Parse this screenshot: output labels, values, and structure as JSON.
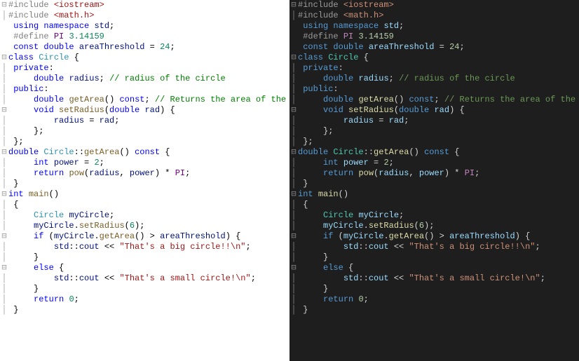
{
  "tokens": {
    "include": "#include",
    "iostream": "<iostream>",
    "math": "<math.h>",
    "using": "using",
    "namespace": "namespace",
    "std": "std",
    "define": "#define",
    "PI": "PI",
    "pi_val": "3.14159",
    "const": "const",
    "double": "double",
    "areaThreshold": "areaThreshold",
    "thresh_val": "24",
    "class": "class",
    "Circle": "Circle",
    "private": "private",
    "public": "public",
    "radius": "radius",
    "cmt_radius": "// radius of the circle",
    "getArea": "getArea",
    "cmt_getarea": "// Returns the area of the circle",
    "void": "void",
    "setRadius": "setRadius",
    "rad": "rad",
    "int": "int",
    "power": "power",
    "two": "2",
    "return": "return",
    "pow": "pow",
    "main": "main",
    "myCircle": "myCircle",
    "six": "6",
    "if": "if",
    "cout": "cout",
    "str_big": "\"That's a big circle!!\\n\"",
    "else": "else",
    "str_small": "\"That's a small circle!\\n\"",
    "zero": "0",
    "semi": ";",
    "colon": ":",
    "dcolon": "::",
    "lbrace": "{",
    "rbrace": "}",
    "lparen": "(",
    "rparen": ")",
    "comma": ",",
    "eq": "=",
    "gt": ">",
    "star": "*",
    "dot": ".",
    "ins": "<<",
    "empty": ""
  },
  "foldMinus": "⊟",
  "foldBar": "│",
  "lines": [
    {
      "g": "m",
      "t": [
        [
          "c-pre",
          "include"
        ],
        [
          "c-def",
          " "
        ],
        [
          "c-inc",
          "iostream"
        ]
      ]
    },
    {
      "g": "b",
      "t": [
        [
          "c-pre",
          "include"
        ],
        [
          "c-def",
          " "
        ],
        [
          "c-inc",
          "math"
        ]
      ]
    },
    {
      "g": "",
      "t": []
    },
    {
      "g": "",
      "t": [
        [
          "c-def",
          " "
        ],
        [
          "c-kw",
          "using"
        ],
        [
          "c-def",
          " "
        ],
        [
          "c-kw",
          "namespace"
        ],
        [
          "c-def",
          " "
        ],
        [
          "c-var",
          "std"
        ],
        [
          "c-def",
          "semi"
        ]
      ]
    },
    {
      "g": "",
      "t": [
        [
          "c-def",
          " "
        ],
        [
          "c-pre",
          "define"
        ],
        [
          "c-def",
          " "
        ],
        [
          "c-macro",
          "PI"
        ],
        [
          "c-def",
          " "
        ],
        [
          "c-num",
          "pi_val"
        ]
      ]
    },
    {
      "g": "",
      "t": [
        [
          "c-def",
          " "
        ],
        [
          "c-kw",
          "const"
        ],
        [
          "c-def",
          " "
        ],
        [
          "c-type",
          "double"
        ],
        [
          "c-def",
          " "
        ],
        [
          "c-var",
          "areaThreshold"
        ],
        [
          "c-def",
          " "
        ],
        [
          "c-def",
          "eq"
        ],
        [
          "c-def",
          " "
        ],
        [
          "c-num",
          "thresh_val"
        ],
        [
          "c-def",
          "semi"
        ]
      ]
    },
    {
      "g": "",
      "t": []
    },
    {
      "g": "m",
      "t": [
        [
          "c-kw",
          "class"
        ],
        [
          "c-def",
          " "
        ],
        [
          "c-typec",
          "Circle"
        ],
        [
          "c-def",
          " "
        ],
        [
          "c-def",
          "lbrace"
        ]
      ]
    },
    {
      "g": "b",
      "t": [
        [
          "c-def",
          " "
        ],
        [
          "c-kw",
          "private"
        ],
        [
          "c-def",
          "colon"
        ]
      ]
    },
    {
      "g": "b",
      "t": [
        [
          "c-def",
          "     "
        ],
        [
          "c-type",
          "double"
        ],
        [
          "c-def",
          " "
        ],
        [
          "c-var",
          "radius"
        ],
        [
          "c-def",
          "semi"
        ],
        [
          "c-def",
          " "
        ],
        [
          "c-cmt",
          "cmt_radius"
        ]
      ]
    },
    {
      "g": "b",
      "t": [
        [
          "c-def",
          " "
        ],
        [
          "c-kw",
          "public"
        ],
        [
          "c-def",
          "colon"
        ]
      ]
    },
    {
      "g": "b",
      "t": [
        [
          "c-def",
          "     "
        ],
        [
          "c-type",
          "double"
        ],
        [
          "c-def",
          " "
        ],
        [
          "c-func",
          "getArea"
        ],
        [
          "c-def",
          "lparen"
        ],
        [
          "c-def",
          "rparen"
        ],
        [
          "c-def",
          " "
        ],
        [
          "c-kw",
          "const"
        ],
        [
          "c-def",
          "semi"
        ],
        [
          "c-def",
          " "
        ],
        [
          "c-cmt",
          "cmt_getarea"
        ]
      ]
    },
    {
      "g": "m",
      "t": [
        [
          "c-def",
          "     "
        ],
        [
          "c-type",
          "void"
        ],
        [
          "c-def",
          " "
        ],
        [
          "c-func",
          "setRadius"
        ],
        [
          "c-def",
          "lparen"
        ],
        [
          "c-type",
          "double"
        ],
        [
          "c-def",
          " "
        ],
        [
          "c-var",
          "rad"
        ],
        [
          "c-def",
          "rparen"
        ],
        [
          "c-def",
          " "
        ],
        [
          "c-def",
          "lbrace"
        ]
      ]
    },
    {
      "g": "b",
      "t": [
        [
          "c-def",
          "         "
        ],
        [
          "c-var",
          "radius"
        ],
        [
          "c-def",
          " "
        ],
        [
          "c-def",
          "eq"
        ],
        [
          "c-def",
          " "
        ],
        [
          "c-var",
          "rad"
        ],
        [
          "c-def",
          "semi"
        ]
      ]
    },
    {
      "g": "b",
      "t": [
        [
          "c-def",
          "     "
        ],
        [
          "c-def",
          "rbrace"
        ],
        [
          "c-def",
          "semi"
        ]
      ]
    },
    {
      "g": "b",
      "t": [
        [
          "c-def",
          " "
        ],
        [
          "c-def",
          "rbrace"
        ],
        [
          "c-def",
          "semi"
        ]
      ]
    },
    {
      "g": "m",
      "t": [
        [
          "c-type",
          "double"
        ],
        [
          "c-def",
          " "
        ],
        [
          "c-typec",
          "Circle"
        ],
        [
          "c-def",
          "dcolon"
        ],
        [
          "c-func",
          "getArea"
        ],
        [
          "c-def",
          "lparen"
        ],
        [
          "c-def",
          "rparen"
        ],
        [
          "c-def",
          " "
        ],
        [
          "c-kw",
          "const"
        ],
        [
          "c-def",
          " "
        ],
        [
          "c-def",
          "lbrace"
        ]
      ]
    },
    {
      "g": "b",
      "t": [
        [
          "c-def",
          "     "
        ],
        [
          "c-type",
          "int"
        ],
        [
          "c-def",
          " "
        ],
        [
          "c-var",
          "power"
        ],
        [
          "c-def",
          " "
        ],
        [
          "c-def",
          "eq"
        ],
        [
          "c-def",
          " "
        ],
        [
          "c-num",
          "two"
        ],
        [
          "c-def",
          "semi"
        ]
      ]
    },
    {
      "g": "b",
      "t": [
        [
          "c-def",
          "     "
        ],
        [
          "c-kw",
          "return"
        ],
        [
          "c-def",
          " "
        ],
        [
          "c-func",
          "pow"
        ],
        [
          "c-def",
          "lparen"
        ],
        [
          "c-var",
          "radius"
        ],
        [
          "c-def",
          "comma"
        ],
        [
          "c-def",
          " "
        ],
        [
          "c-var",
          "power"
        ],
        [
          "c-def",
          "rparen"
        ],
        [
          "c-def",
          " "
        ],
        [
          "c-def",
          "star"
        ],
        [
          "c-def",
          " "
        ],
        [
          "c-macro",
          "PI"
        ],
        [
          "c-def",
          "semi"
        ]
      ]
    },
    {
      "g": "b",
      "t": [
        [
          "c-def",
          " "
        ],
        [
          "c-def",
          "rbrace"
        ]
      ]
    },
    {
      "g": "",
      "t": []
    },
    {
      "g": "",
      "t": []
    },
    {
      "g": "m",
      "t": [
        [
          "c-type",
          "int"
        ],
        [
          "c-def",
          " "
        ],
        [
          "c-func",
          "main"
        ],
        [
          "c-def",
          "lparen"
        ],
        [
          "c-def",
          "rparen"
        ]
      ]
    },
    {
      "g": "b",
      "t": [
        [
          "c-def",
          " "
        ],
        [
          "c-def",
          "lbrace"
        ]
      ]
    },
    {
      "g": "b",
      "t": [
        [
          "c-def",
          "     "
        ],
        [
          "c-typec",
          "Circle"
        ],
        [
          "c-def",
          " "
        ],
        [
          "c-var",
          "myCircle"
        ],
        [
          "c-def",
          "semi"
        ]
      ]
    },
    {
      "g": "b",
      "t": [
        [
          "c-def",
          "     "
        ],
        [
          "c-var",
          "myCircle"
        ],
        [
          "c-def",
          "dot"
        ],
        [
          "c-func",
          "setRadius"
        ],
        [
          "c-def",
          "lparen"
        ],
        [
          "c-num",
          "six"
        ],
        [
          "c-def",
          "rparen"
        ],
        [
          "c-def",
          "semi"
        ]
      ]
    },
    {
      "g": "m",
      "t": [
        [
          "c-def",
          "     "
        ],
        [
          "c-kw",
          "if"
        ],
        [
          "c-def",
          " "
        ],
        [
          "c-def",
          "lparen"
        ],
        [
          "c-var",
          "myCircle"
        ],
        [
          "c-def",
          "dot"
        ],
        [
          "c-func",
          "getArea"
        ],
        [
          "c-def",
          "lparen"
        ],
        [
          "c-def",
          "rparen"
        ],
        [
          "c-def",
          " "
        ],
        [
          "c-def",
          "gt"
        ],
        [
          "c-def",
          " "
        ],
        [
          "c-var",
          "areaThreshold"
        ],
        [
          "c-def",
          "rparen"
        ],
        [
          "c-def",
          " "
        ],
        [
          "c-def",
          "lbrace"
        ]
      ]
    },
    {
      "g": "b",
      "t": [
        [
          "c-def",
          "         "
        ],
        [
          "c-var",
          "std"
        ],
        [
          "c-def",
          "dcolon"
        ],
        [
          "c-var",
          "cout"
        ],
        [
          "c-def",
          " "
        ],
        [
          "c-def",
          "ins"
        ],
        [
          "c-def",
          " "
        ],
        [
          "c-str",
          "str_big"
        ],
        [
          "c-def",
          "semi"
        ]
      ]
    },
    {
      "g": "b",
      "t": [
        [
          "c-def",
          "     "
        ],
        [
          "c-def",
          "rbrace"
        ]
      ]
    },
    {
      "g": "m",
      "t": [
        [
          "c-def",
          "     "
        ],
        [
          "c-kw",
          "else"
        ],
        [
          "c-def",
          " "
        ],
        [
          "c-def",
          "lbrace"
        ]
      ]
    },
    {
      "g": "b",
      "t": [
        [
          "c-def",
          "         "
        ],
        [
          "c-var",
          "std"
        ],
        [
          "c-def",
          "dcolon"
        ],
        [
          "c-var",
          "cout"
        ],
        [
          "c-def",
          " "
        ],
        [
          "c-def",
          "ins"
        ],
        [
          "c-def",
          " "
        ],
        [
          "c-str",
          "str_small"
        ],
        [
          "c-def",
          "semi"
        ]
      ]
    },
    {
      "g": "b",
      "t": [
        [
          "c-def",
          "     "
        ],
        [
          "c-def",
          "rbrace"
        ]
      ]
    },
    {
      "g": "b",
      "t": [
        [
          "c-def",
          "     "
        ],
        [
          "c-kw",
          "return"
        ],
        [
          "c-def",
          " "
        ],
        [
          "c-num",
          "zero"
        ],
        [
          "c-def",
          "semi"
        ]
      ]
    },
    {
      "g": "b",
      "t": [
        [
          "c-def",
          " "
        ],
        [
          "c-def",
          "rbrace"
        ]
      ]
    }
  ]
}
